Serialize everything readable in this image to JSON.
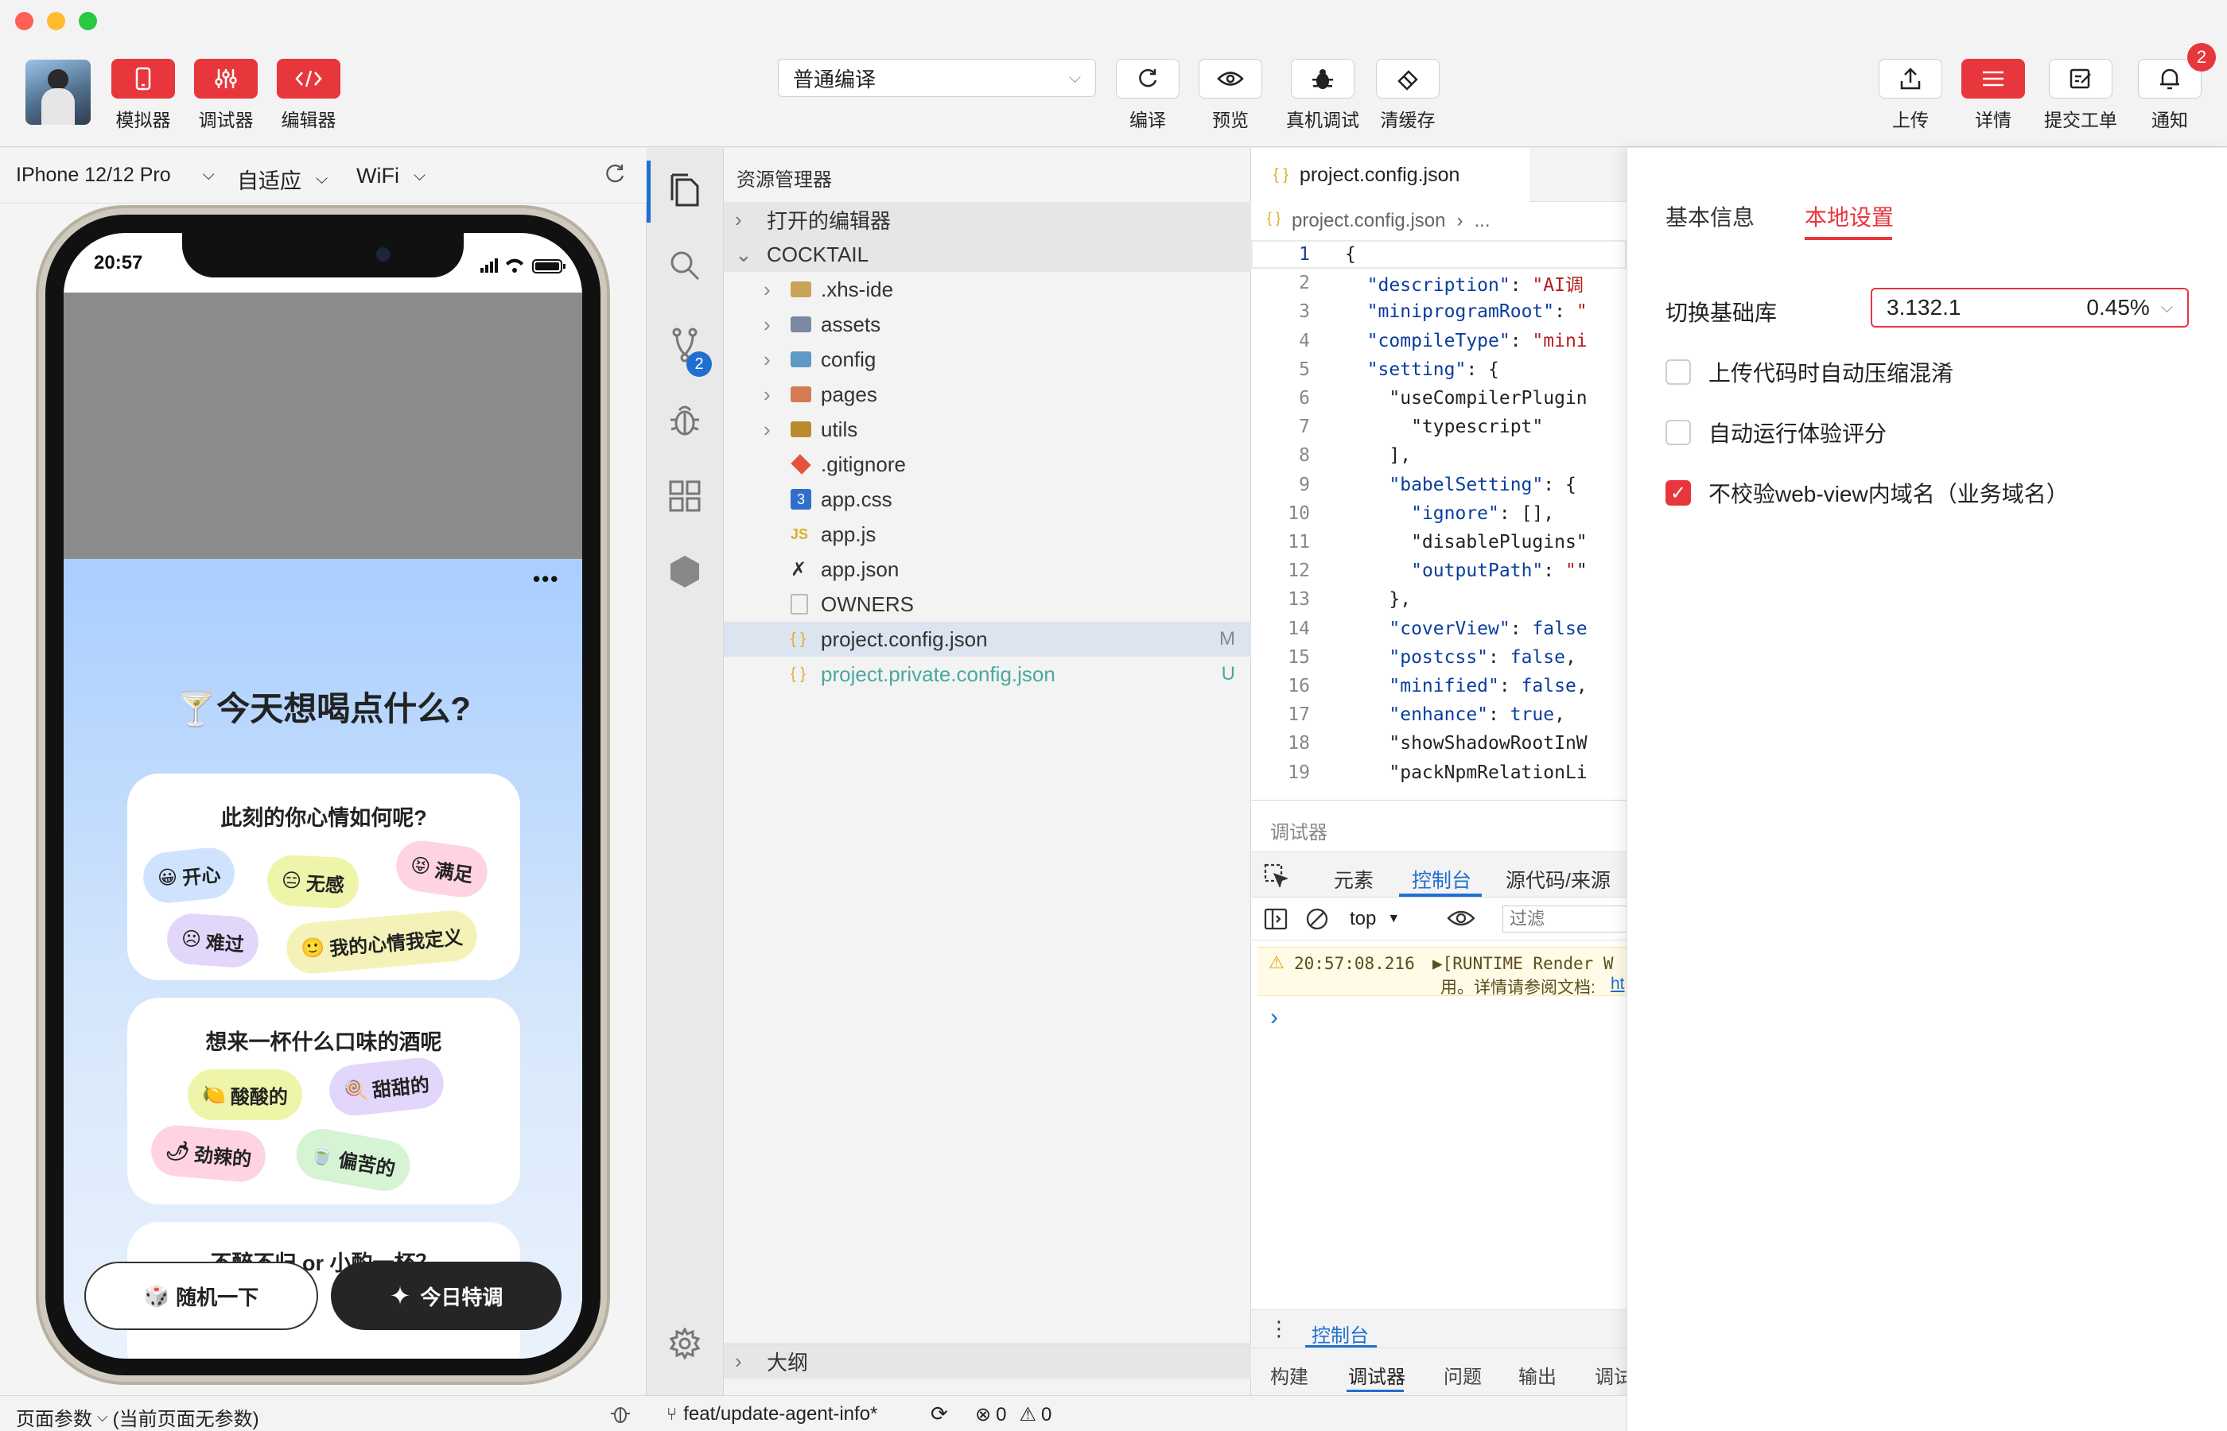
{
  "toolbar": {
    "simulator": "模拟器",
    "debugger": "调试器",
    "editor": "编辑器",
    "compile_mode": "普通编译",
    "compile": "编译",
    "preview": "预览",
    "real_debug": "真机调试",
    "clear_cache": "清缓存",
    "upload": "上传",
    "details": "详情",
    "ticket": "提交工单",
    "notify": "通知",
    "notify_count": "2"
  },
  "device": {
    "model": "IPhone 12/12 Pro",
    "fit": "自适应",
    "network": "WiFi"
  },
  "phone": {
    "time": "20:57",
    "more": "•••",
    "heading": "🍸今天想喝点什么?",
    "mood_title": "此刻的你心情如何呢?",
    "moods": [
      {
        "emoji": "😀",
        "label": "开心"
      },
      {
        "emoji": "😑",
        "label": "无感"
      },
      {
        "emoji": "😝",
        "label": "满足"
      },
      {
        "emoji": "☹",
        "label": "难过"
      },
      {
        "emoji": "🙂",
        "label": "我的心情我定义"
      }
    ],
    "flavor_title": "想来一杯什么口味的酒呢",
    "flavors": [
      {
        "emoji": "🍋",
        "label": "酸酸的"
      },
      {
        "emoji": "🍭",
        "label": "甜甜的"
      },
      {
        "emoji": "🌶",
        "label": "劲辣的"
      },
      {
        "emoji": "🍵",
        "label": "偏苦的"
      }
    ],
    "third_title": "不醉不归 or 小酌一杯？",
    "random_btn": "随机一下",
    "random_emoji": "🎲",
    "special_btn": "今日特调",
    "special_icon": "✦"
  },
  "activity": {
    "scm_badge": "2"
  },
  "explorer": {
    "title": "资源管理器",
    "open_editors": "打开的编辑器",
    "project": "COCKTAIL",
    "items": [
      {
        "name": ".xhs-ide",
        "status": ""
      },
      {
        "name": "assets",
        "status": ""
      },
      {
        "name": "config",
        "status": ""
      },
      {
        "name": "pages",
        "status": ""
      },
      {
        "name": "utils",
        "status": ""
      },
      {
        "name": ".gitignore",
        "status": ""
      },
      {
        "name": "app.css",
        "status": ""
      },
      {
        "name": "app.js",
        "status": ""
      },
      {
        "name": "app.json",
        "status": ""
      },
      {
        "name": "OWNERS",
        "status": ""
      },
      {
        "name": "project.config.json",
        "status": "M"
      },
      {
        "name": "project.private.config.json",
        "status": "U"
      }
    ],
    "outline": "大纲"
  },
  "editor": {
    "tab": "project.config.json",
    "breadcrumb_file": "project.config.json",
    "breadcrumb_more": "...",
    "lines": [
      "{",
      "  \"description\": \"AI调",
      "  \"miniprogramRoot\": \"",
      "  \"compileType\": \"mini",
      "  \"setting\": {",
      "    \"useCompilerPlugin",
      "      \"typescript\"",
      "    ],",
      "    \"babelSetting\": {",
      "      \"ignore\": [],",
      "      \"disablePlugins\"",
      "      \"outputPath\": \"\"",
      "    },",
      "    \"coverView\": false",
      "    \"postcss\": false,",
      "    \"minified\": false,",
      "    \"enhance\": true,",
      "    \"showShadowRootInW",
      "    \"packNpmRelationLi"
    ]
  },
  "debugger": {
    "title": "调试器",
    "tabs": [
      "元素",
      "控制台",
      "源代码/来源"
    ],
    "context": "top",
    "filter_placeholder": "过滤",
    "log_time": "20:57:08.216",
    "log_text1": "▶[RUNTIME Render W",
    "log_text2": "用。详情请参阅文档:",
    "log_link": "ht",
    "prompt": "›",
    "drawer_tab": "控制台",
    "bottom_tabs": [
      "构建",
      "调试器",
      "问题",
      "输出",
      "调试"
    ]
  },
  "settings": {
    "tab_basic": "基本信息",
    "tab_local": "本地设置",
    "base_lib_label": "切换基础库",
    "base_lib_version": "3.132.1",
    "base_lib_share": "0.45%",
    "options": [
      {
        "label": "上传代码时自动压缩混淆",
        "checked": false
      },
      {
        "label": "自动运行体验评分",
        "checked": false
      },
      {
        "label": "不校验web-view内域名（业务域名）",
        "checked": true
      }
    ]
  },
  "status": {
    "page_params": "页面参数",
    "page_params_hint": "(当前页面无参数)",
    "branch": "feat/update-agent-info*",
    "errors": "0",
    "warnings": "0"
  },
  "colors": {
    "accent": "#e8363d",
    "vscode_blue": "#1f6fd1",
    "mood_bg": "#cfe3ff"
  }
}
